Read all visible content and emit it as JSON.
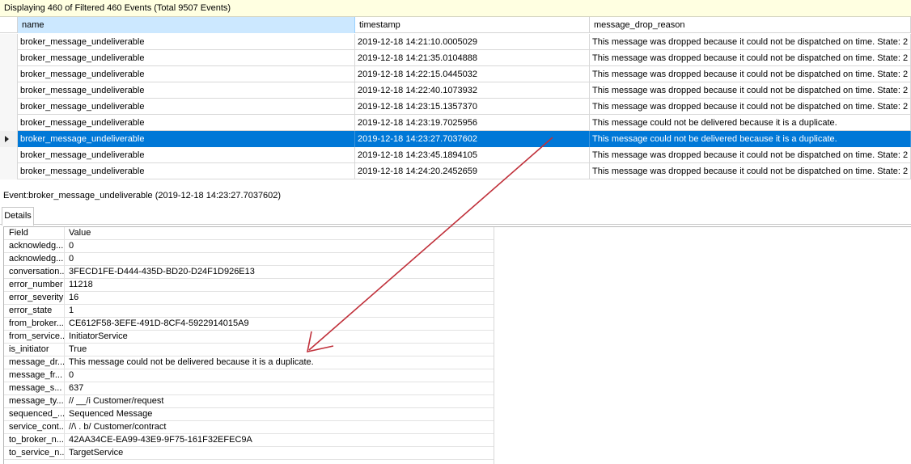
{
  "status_bar": {
    "text": "Displaying 460 of Filtered 460 Events (Total 9507 Events)"
  },
  "grid": {
    "columns": [
      "name",
      "timestamp",
      "message_drop_reason"
    ],
    "rows": [
      {
        "name": "broker_message_undeliverable",
        "timestamp": "2019-12-18 14:21:10.0005029",
        "reason": "This message was dropped because it could not be dispatched on time. State: 2"
      },
      {
        "name": "broker_message_undeliverable",
        "timestamp": "2019-12-18 14:21:35.0104888",
        "reason": "This message was dropped because it could not be dispatched on time. State: 2"
      },
      {
        "name": "broker_message_undeliverable",
        "timestamp": "2019-12-18 14:22:15.0445032",
        "reason": "This message was dropped because it could not be dispatched on time. State: 2"
      },
      {
        "name": "broker_message_undeliverable",
        "timestamp": "2019-12-18 14:22:40.1073932",
        "reason": "This message was dropped because it could not be dispatched on time. State: 2"
      },
      {
        "name": "broker_message_undeliverable",
        "timestamp": "2019-12-18 14:23:15.1357370",
        "reason": "This message was dropped because it could not be dispatched on time. State: 2"
      },
      {
        "name": "broker_message_undeliverable",
        "timestamp": "2019-12-18 14:23:19.7025956",
        "reason": "This message could not be delivered because it is a duplicate."
      },
      {
        "name": "broker_message_undeliverable",
        "timestamp": "2019-12-18 14:23:27.7037602",
        "reason": "This message could not be delivered because it is a duplicate."
      },
      {
        "name": "broker_message_undeliverable",
        "timestamp": "2019-12-18 14:23:45.1894105",
        "reason": "This message was dropped because it could not be dispatched on time. State: 2"
      },
      {
        "name": "broker_message_undeliverable",
        "timestamp": "2019-12-18 14:24:20.2452659",
        "reason": "This message was dropped because it could not be dispatched on time. State: 2"
      }
    ],
    "selected_row": 6
  },
  "event_title": "Event:broker_message_undeliverable (2019-12-18 14:23:27.7037602)",
  "details_tab": {
    "label": "Details"
  },
  "details": {
    "header_field": "Field",
    "header_value": "Value",
    "rows": [
      {
        "field": "acknowledg...",
        "value": "0"
      },
      {
        "field": "acknowledg...",
        "value": "0"
      },
      {
        "field": "conversation...",
        "value": "3FECD1FE-D444-435D-BD20-D24F1D926E13"
      },
      {
        "field": "error_number",
        "value": "11218"
      },
      {
        "field": "error_severity",
        "value": "16"
      },
      {
        "field": "error_state",
        "value": "1"
      },
      {
        "field": "from_broker...",
        "value": "CE612F58-3EFE-491D-8CF4-5922914015A9"
      },
      {
        "field": "from_service...",
        "value": "InitiatorService"
      },
      {
        "field": "is_initiator",
        "value": "True"
      },
      {
        "field": "message_dr...",
        "value": "This message could not be delivered because it is a duplicate."
      },
      {
        "field": "message_fr...",
        "value": "0"
      },
      {
        "field": "message_s...",
        "value": "637"
      },
      {
        "field": "message_ty...",
        "value": "//        __/i       Customer/request"
      },
      {
        "field": "sequenced_...",
        "value": "Sequenced Message"
      },
      {
        "field": "service_cont...",
        "value": "//\\    .    b/       Customer/contract"
      },
      {
        "field": "to_broker_n...",
        "value": "42AA34CE-EA99-43E9-9F75-161F32EFEC9A"
      },
      {
        "field": "to_service_n...",
        "value": "TargetService"
      }
    ]
  },
  "annotation": {
    "arrow_color": "#c0303a"
  }
}
